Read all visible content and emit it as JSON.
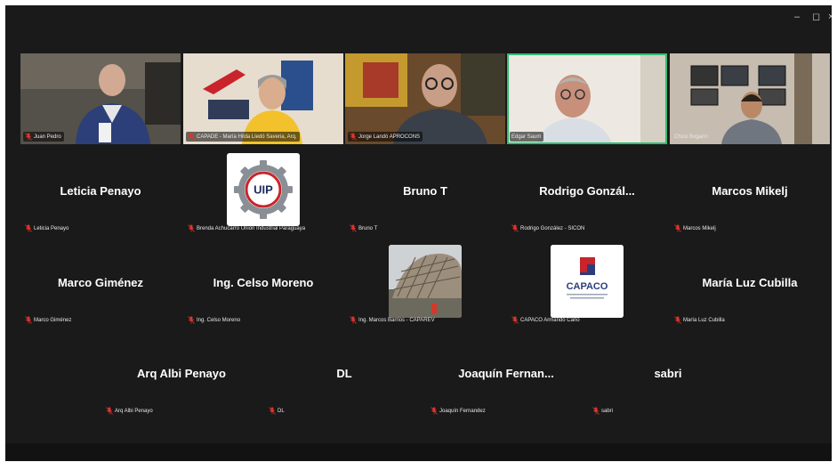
{
  "window_controls": {
    "minimize": "–",
    "restore": "◻",
    "close": "×"
  },
  "colors": {
    "background": "#1a1a1a",
    "active_speaker_border": "#2fbf71",
    "mic_muted": "#e0342b"
  },
  "video_tiles": [
    {
      "label": "Juan Pedro"
    },
    {
      "label": "CAPADE - María Hilda Lledó Saveria, Arq."
    },
    {
      "label": "Jorge Landó APROCONS"
    },
    {
      "label": "Edgar Saum",
      "active": true
    },
    {
      "label": "Chico Bogarin"
    }
  ],
  "logo_text": {
    "uip": "UIP",
    "capaco": "CAPACO"
  },
  "participants": {
    "leticia": {
      "display": "Leticia Penayo",
      "label": "Leticia Penayo"
    },
    "brenda": {
      "label": "Brenda Achucarro Unión Industrial Paraguaya"
    },
    "bruno": {
      "display": "Bruno T",
      "label": "Bruno T"
    },
    "rodrigo": {
      "display": "Rodrigo  Gonzál...",
      "label": "Rodrigo González - SICON"
    },
    "marcos_m": {
      "display": "Marcos Mikelj",
      "label": "Marcos Mikelj"
    },
    "marco_g": {
      "display": "Marco Giménez",
      "label": "Marco Giménez"
    },
    "celso": {
      "display": "Ing. Celso Moreno",
      "label": "Ing. Celso Moreno"
    },
    "marcos_b": {
      "label": "Ing. Marcos Barrios - CAPAREV"
    },
    "capaco": {
      "label": "CAPACO Armando Cano"
    },
    "maria_luz": {
      "display": "María Luz Cubilla",
      "label": "María Luz Cubilla"
    },
    "albi": {
      "display": "Arq Albi Penayo",
      "label": "Arq Albi Penayo"
    },
    "dl": {
      "display": "DL",
      "label": "DL"
    },
    "joaquin": {
      "display": "Joaquín  Fernan...",
      "label": "Joaquín Fernandez"
    },
    "sabri": {
      "display": "sabri",
      "label": "sabri"
    }
  }
}
